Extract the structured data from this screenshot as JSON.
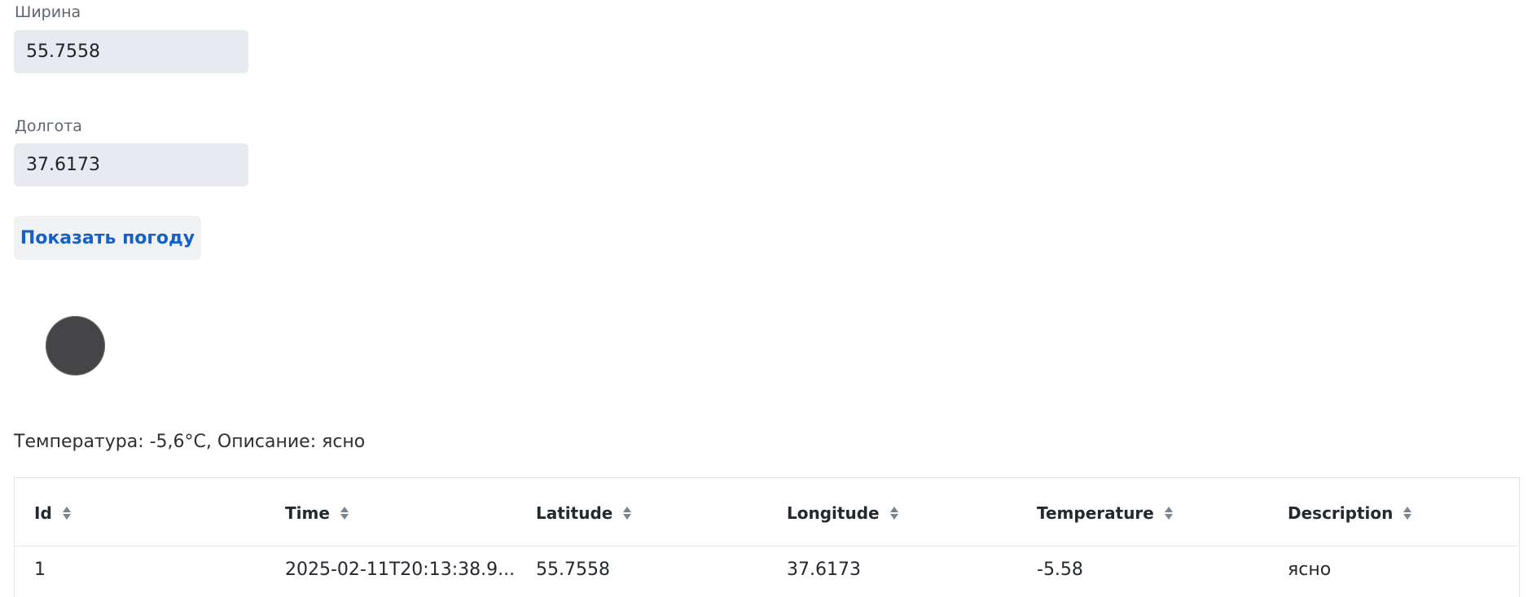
{
  "form": {
    "latitude_label": "Ширина",
    "latitude_value": "55.7558",
    "longitude_label": "Долгота",
    "longitude_value": "37.6173",
    "submit_label": "Показать погоду"
  },
  "weather": {
    "icon": "weather-icon",
    "summary": "Температура: -5,6°C, Описание: ясно"
  },
  "table": {
    "columns": [
      "Id",
      "Time",
      "Latitude",
      "Longitude",
      "Temperature",
      "Description"
    ],
    "rows": [
      [
        "1",
        "2025-02-11T20:13:38.9...",
        "55.7558",
        "37.6173",
        "-5.58",
        "ясно"
      ]
    ]
  },
  "colors": {
    "accent": "#1661c9",
    "input_bg": "#e7eaee",
    "icon": "#454547"
  }
}
